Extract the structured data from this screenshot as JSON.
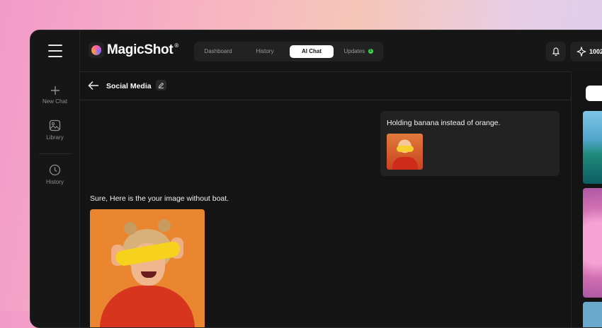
{
  "app": {
    "name": "MagicShot",
    "reg": "®"
  },
  "sidebar": {
    "items": [
      {
        "label": "New Chat",
        "icon": "plus-icon"
      },
      {
        "label": "Library",
        "icon": "image-icon"
      },
      {
        "label": "History",
        "icon": "clock-icon"
      }
    ]
  },
  "nav": {
    "tabs": [
      {
        "label": "Dashboard",
        "active": false
      },
      {
        "label": "History",
        "active": false
      },
      {
        "label": "AI Chat",
        "active": true
      },
      {
        "label": "Updates",
        "active": false,
        "badge": "1"
      }
    ]
  },
  "header": {
    "credits": "1002"
  },
  "chat": {
    "title": "Social Media",
    "user_message": "Holding banana instead of orange.",
    "assistant_message": "Sure, Here is the your image without boat."
  },
  "colors": {
    "active_tab_bg": "#ffffff",
    "badge_green": "#3dd34f",
    "frame_bg": "#141414"
  }
}
